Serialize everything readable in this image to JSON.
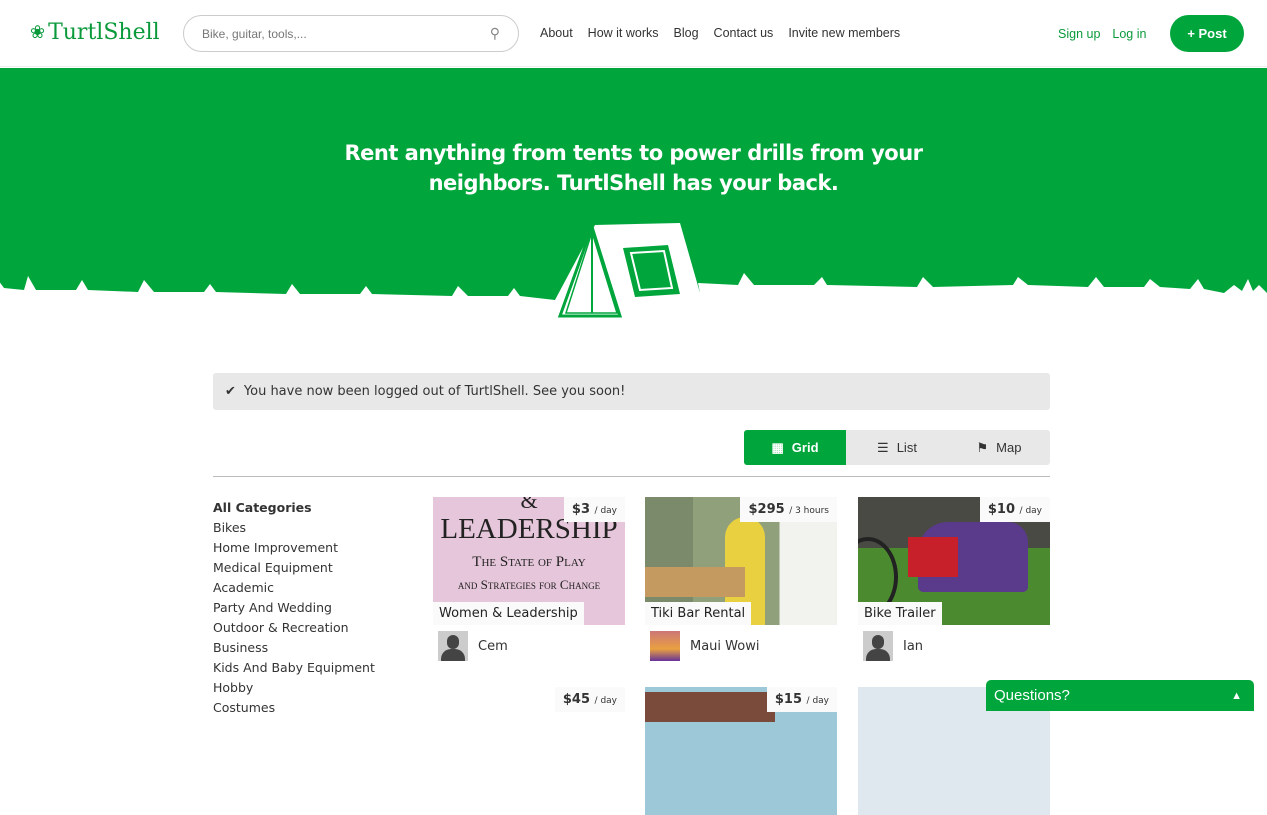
{
  "brand": {
    "name": "TurtlShell",
    "green": "#00a63c",
    "logo_green": "#0a9a3b"
  },
  "search": {
    "placeholder": "Bike, guitar, tools,..."
  },
  "nav": [
    "About",
    "How it works",
    "Blog",
    "Contact us",
    "Invite new members"
  ],
  "auth": {
    "signup": "Sign up",
    "login": "Log in",
    "post": "+ Post"
  },
  "hero": {
    "line1": "Rent anything from tents to power drills from your",
    "line2": "neighbors. TurtlShell has your back."
  },
  "flash": "You have now been logged out of TurtlShell. See you soon!",
  "views": [
    "Grid",
    "List",
    "Map"
  ],
  "categories": [
    "All Categories",
    "Bikes",
    "Home Improvement",
    "Medical Equipment",
    "Academic",
    "Party And Wedding",
    "Outdoor & Recreation",
    "Business",
    "Kids And Baby Equipment",
    "Hobby",
    "Costumes"
  ],
  "listings": [
    {
      "price": "$3",
      "unit": "/ day",
      "title": "Women & Leadership",
      "owner": "Cem",
      "cover": [
        "&",
        "LEADERSHIP",
        "The State of Play",
        "and Strategies for Change"
      ]
    },
    {
      "price": "$295",
      "unit": "/ 3 hours",
      "title": "Tiki Bar Rental",
      "owner": "Maui Wowi"
    },
    {
      "price": "$10",
      "unit": "/ day",
      "title": "Bike Trailer",
      "owner": "Ian"
    },
    {
      "price": "$45",
      "unit": "/ day"
    },
    {
      "price": "$15",
      "unit": "/ day"
    }
  ],
  "chat": "Questions?"
}
